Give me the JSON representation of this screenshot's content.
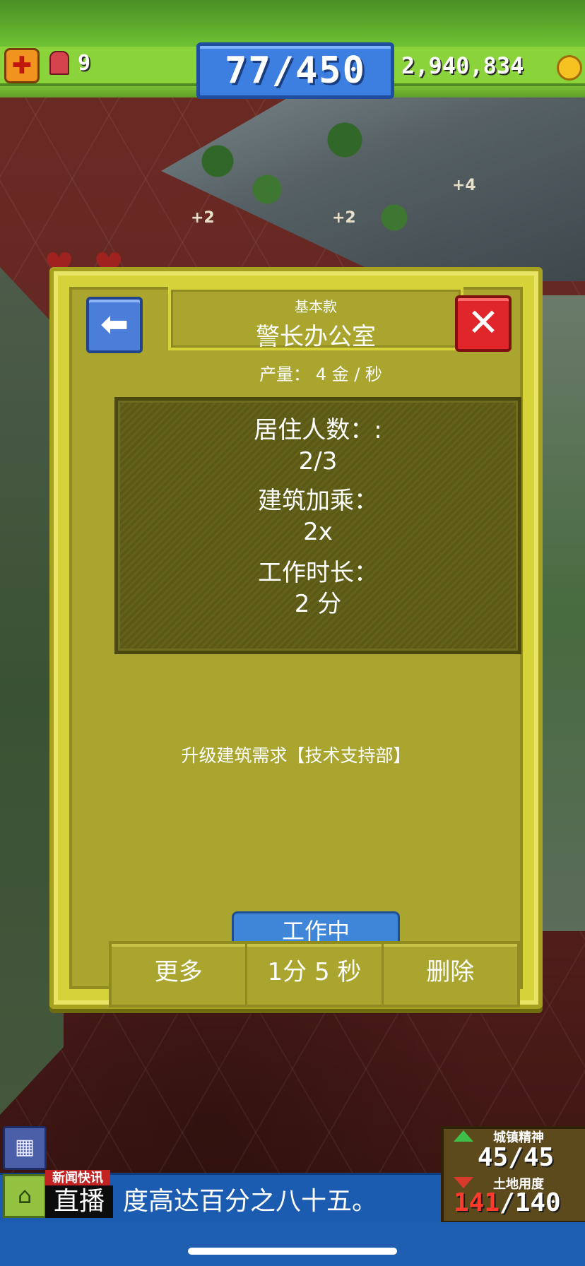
{
  "hud": {
    "siren_count": "9",
    "population": "77/450",
    "gold": "2,940,834"
  },
  "scene": {
    "floating_bonuses": [
      "+2",
      "+2",
      "+4"
    ]
  },
  "dialog": {
    "subtitle": "基本款",
    "title": "警长办公室",
    "output": "产量： 4 金 / 秒",
    "stats": [
      {
        "label": "居住人数：:",
        "value": "2/3"
      },
      {
        "label": "建筑加乘：",
        "value": "2x"
      },
      {
        "label": "工作时长：",
        "value": "2 分"
      }
    ],
    "upgrade_requirement": "升级建筑需求【技术支持部】",
    "status_tab": "工作中",
    "buttons": {
      "more": "更多",
      "timer": "1分 5 秒",
      "delete": "删除"
    }
  },
  "bottom": {
    "news_label": "新闻快讯",
    "live_label": "直播",
    "news_text": "度高达百分之八十五。",
    "panel_label_top": "城镇精神",
    "panel_value_top": "45/45",
    "panel_label_bottom": "土地用度",
    "panel_value_bottom_used": "141",
    "panel_value_bottom_total": "/140"
  },
  "colors": {
    "dialog_bg": "#d6d23a",
    "dialog_inner": "#a9a52e",
    "back_button": "#4a7ed8",
    "close_button": "#e0262a",
    "population_box": "#3d7fe0",
    "hud_green": "#8ad33a"
  },
  "icons": {
    "hud_left": "medkit-icon",
    "hud_siren": "siren-icon",
    "coin": "gold-coin-icon",
    "back": "back-arrow-icon",
    "close": "close-x-icon",
    "calendar": "calendar-icon",
    "home": "home-icon"
  }
}
